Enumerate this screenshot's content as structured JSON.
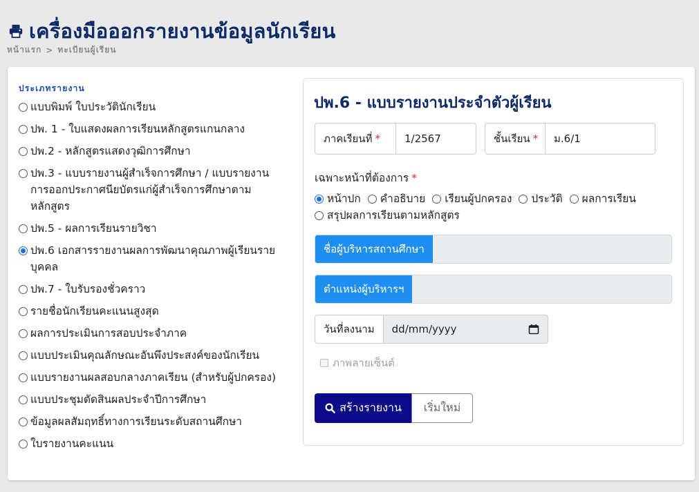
{
  "header": {
    "title": "เครื่องมือออกรายงานข้อมูลนักเรียน",
    "icon": "printer-icon",
    "color": "#0d2a66"
  },
  "breadcrumb": {
    "items": [
      "หน้าแรก",
      "ทะเบียนผู้เรียน"
    ],
    "separator": ">"
  },
  "sidebar": {
    "heading": "ประเภทรายงาน",
    "items": [
      {
        "label": "แบบพิมพ์ ใบประวัตินักเรียน",
        "checked": false
      },
      {
        "label": "ปพ. 1 - ใบแสดงผลการเรียนหลักสูตรแกนกลาง",
        "checked": false
      },
      {
        "label": "ปพ.2 - หลักสูตรแสดงวุฒิการศึกษา",
        "checked": false
      },
      {
        "label": "ปพ.3 - แบบรายงานผู้สำเร็จการศึกษา / แบบรายงานการออกประกาศนียบัตรแก่ผู้สำเร็จการศึกษาตามหลักสูตร",
        "checked": false
      },
      {
        "label": "ปพ.5 - ผลการเรียนรายวิชา",
        "checked": false
      },
      {
        "label": "ปพ.6 เอกสารรายงานผลการพัฒนาคุณภาพผู้เรียนรายบุคคล",
        "checked": true
      },
      {
        "label": "ปพ.7 - ใบรับรองชั่วคราว",
        "checked": false
      },
      {
        "label": "รายชื่อนักเรียนคะแนนสูงสุด",
        "checked": false
      },
      {
        "label": "ผลการประเมินการสอบประจำภาค",
        "checked": false
      },
      {
        "label": "แบบประเมินคุณลักษณะอันพึงประสงค์ของนักเรียน",
        "checked": false
      },
      {
        "label": "แบบรายงานผลสอบกลางภาคเรียน (สำหรับผู้ปกครอง)",
        "checked": false
      },
      {
        "label": "แบบประชุมตัดสินผลประจำปีการศึกษา",
        "checked": false
      },
      {
        "label": "ข้อมูลผลสัมฤทธิ์ทางการเรียนระดับสถานศึกษา",
        "checked": false
      },
      {
        "label": "ใบรายงานคะแนน",
        "checked": false
      }
    ]
  },
  "form": {
    "title": "ปพ.6 - แบบรายงานประจำตัวผู้เรียน",
    "semester_label": "ภาคเรียนที่",
    "semester_value": "1/2567",
    "class_label": "ชั้นเรียน",
    "class_value": "ม.6/1",
    "required_mark": "*",
    "pages_label": "เฉพาะหน้าที่ต้องการ",
    "pages": [
      {
        "label": "หน้าปก",
        "checked": true
      },
      {
        "label": "คำอธิบาย",
        "checked": false
      },
      {
        "label": "เรียนผู้ปกครอง",
        "checked": false
      },
      {
        "label": "ประวัติ",
        "checked": false
      },
      {
        "label": "ผลการเรียน",
        "checked": false
      },
      {
        "label": "สรุปผลการเรียนตามหลักสูตร",
        "checked": false
      }
    ],
    "director_name_label": "ชื่อผู้บริหารสถานศึกษา",
    "director_position_label": "ตำแหน่งผู้บริหารฯ",
    "sign_date_label": "วันที่ลงนาม",
    "sign_date_placeholder": "dd/mm/yyyy",
    "watermark_label": "ภาพลายเซ็นต์",
    "generate_button": "สร้างรายงาน",
    "reset_button": "เริ่มใหม่"
  },
  "colors": {
    "primary_button": "#0b0b8a",
    "tag_blue": "#1f8ef1",
    "radio_checked": "#1a6fe0",
    "required": "#d32f2f"
  }
}
